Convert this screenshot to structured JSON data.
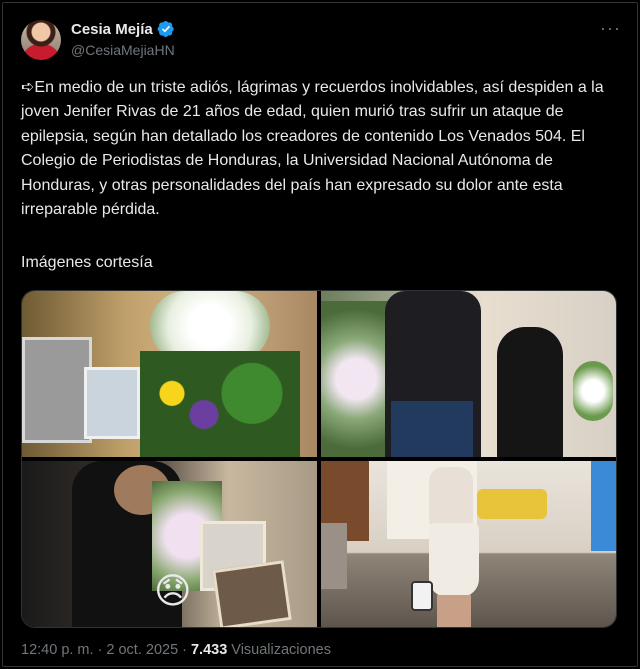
{
  "tweet": {
    "author": {
      "display_name": "Cesia Mejía",
      "handle": "@CesiaMejiaHN",
      "verified_icon": "verified-badge-icon",
      "accent_color": "#1d9bf0"
    },
    "more_icon": "more-horizontal-icon",
    "text": "➪En medio de un triste adiós, lágrimas y recuerdos inolvidables, así despiden a la joven Jenifer Rivas de 21 años de edad, quien murió tras sufrir un ataque de epilepsia, según han detallado los creadores de contenido Los Venados 504. El Colegio de Periodistas de Honduras, la Universidad Nacional Autónoma de Honduras, y otras personalidades del país han expresado su dolor ante esta irreparable pérdida.",
    "caption": "Imágenes cortesía",
    "emoji_overlay": "😞",
    "footer": {
      "time": "12:40 p. m.",
      "separator": "·",
      "date": "2 oct. 2025",
      "separator2": "·",
      "views_count": "7.433",
      "views_label": "Visualizaciones"
    }
  }
}
